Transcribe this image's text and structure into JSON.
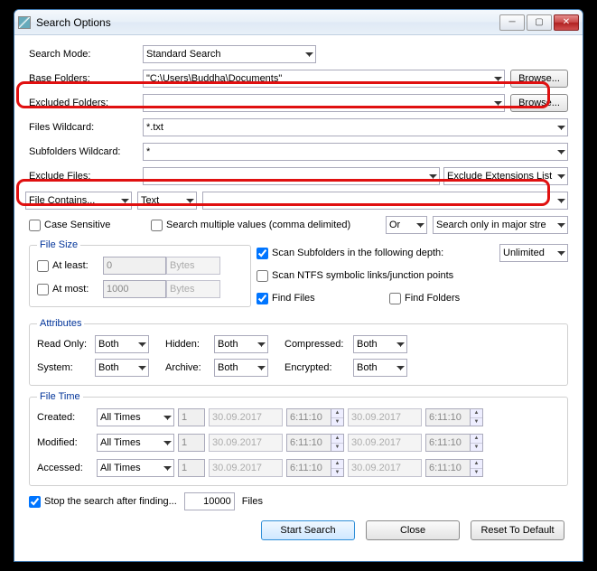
{
  "title": "Search Options",
  "labels": {
    "searchMode": "Search Mode:",
    "baseFolders": "Base Folders:",
    "excludedFolders": "Excluded Folders:",
    "filesWildcard": "Files Wildcard:",
    "subfoldersWildcard": "Subfolders Wildcard:",
    "excludeFiles": "Exclude Files:",
    "caseSensitive": "Case Sensitive",
    "searchMultiple": "Search multiple values (comma delimited)",
    "fileSize": "File Size",
    "atLeast": "At least:",
    "atMost": "At most:",
    "scanSubfolders": "Scan Subfolders in the following depth:",
    "scanNTFS": "Scan NTFS symbolic links/junction points",
    "findFiles": "Find Files",
    "findFolders": "Find Folders",
    "attributes": "Attributes",
    "readOnly": "Read Only:",
    "hidden": "Hidden:",
    "compressed": "Compressed:",
    "system": "System:",
    "archive": "Archive:",
    "encrypted": "Encrypted:",
    "fileTime": "File Time",
    "created": "Created:",
    "modified": "Modified:",
    "accessed": "Accessed:",
    "stopAfter": "Stop the search after finding...",
    "files": "Files"
  },
  "values": {
    "searchMode": "Standard Search",
    "baseFolders": "\"C:\\Users\\Buddha\\Documents\"",
    "excludedFolders": "",
    "filesWildcard": "*.txt",
    "subfoldersWildcard": "*",
    "excludeFiles": "",
    "excludeExtList": "Exclude Extensions List",
    "fileContains": "File Contains...",
    "text": "Text",
    "contentValue": "",
    "or": "Or",
    "majorStreams": "Search only in major stre",
    "atLeast": "0",
    "atMost": "1000",
    "bytes": "Bytes",
    "unlimited": "Unlimited",
    "both": "Both",
    "allTimes": "All Times",
    "one": "1",
    "date": "30.09.2017",
    "time": "6:11:10",
    "stopCount": "10000"
  },
  "buttons": {
    "browse": "Browse...",
    "start": "Start Search",
    "close": "Close",
    "reset": "Reset To Default"
  },
  "checks": {
    "caseSensitive": false,
    "searchMultiple": false,
    "atLeast": false,
    "atMost": false,
    "scanSubfolders": true,
    "scanNTFS": false,
    "findFiles": true,
    "findFolders": false,
    "stopAfter": true
  }
}
